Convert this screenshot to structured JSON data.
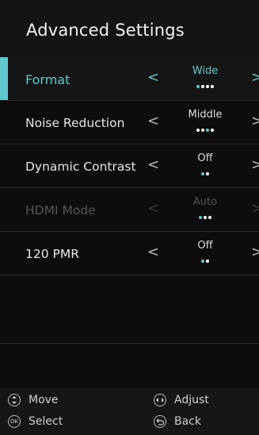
{
  "header": {
    "title": "Advanced Settings"
  },
  "settings": [
    {
      "label": "Format",
      "value": "Wide",
      "dots_total": 4,
      "dots_selected": 1,
      "state": "selected"
    },
    {
      "label": "Noise Reduction",
      "value": "Middle",
      "dots_total": 4,
      "dots_selected": 3,
      "state": "normal"
    },
    {
      "label": "Dynamic Contrast",
      "value": "Off",
      "dots_total": 2,
      "dots_selected": 1,
      "state": "normal"
    },
    {
      "label": "HDMI Mode",
      "value": "Auto",
      "dots_total": 3,
      "dots_selected": 1,
      "state": "disabled"
    },
    {
      "label": "120 PMR",
      "value": "Off",
      "dots_total": 2,
      "dots_selected": 1,
      "state": "normal"
    }
  ],
  "arrows": {
    "left": "<",
    "right": ">"
  },
  "footer": {
    "move": "Move",
    "adjust": "Adjust",
    "select": "Select",
    "back": "Back",
    "ok_glyph": "OK"
  },
  "colors": {
    "accent": "#5fc9cf",
    "background": "#0d0d0d"
  }
}
